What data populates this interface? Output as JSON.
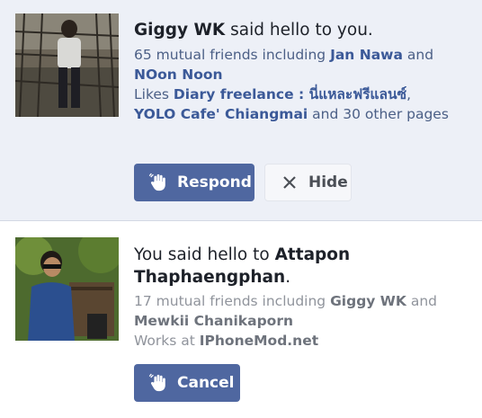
{
  "requests": [
    {
      "name": "Giggy WK",
      "action_text": "said hello to you.",
      "mutual_prefix": "65 mutual friends including",
      "mutual_friend_1": "Jan Nawa",
      "mutual_conj": "and",
      "mutual_friend_2": "NOon Noon",
      "likes_prefix": "Likes",
      "like_1": "Diary freelance : นี่แหละฟรีแลนซ์",
      "like_sep": ",",
      "like_2": "YOLO Cafe' Chiangmai",
      "likes_suffix": "and 30 other pages",
      "respond_label": "Respond",
      "hide_label": "Hide"
    },
    {
      "action_text": "You said hello to",
      "name": "Attapon Thaphaengphan",
      "name_suffix": ".",
      "mutual_prefix": "17 mutual friends including",
      "mutual_friend_1": "Giggy WK",
      "mutual_conj": "and",
      "mutual_friend_2": "Mewkii Chanikaporn",
      "works_prefix": "Works at",
      "works_at": "IPhoneMod.net",
      "cancel_label": "Cancel"
    }
  ],
  "icons": {
    "wave": "waving-hand-icon",
    "close": "close-icon"
  },
  "colors": {
    "card_highlight": "#edf0f7",
    "button_primary": "#4f67a0",
    "link": "#3b5998"
  }
}
